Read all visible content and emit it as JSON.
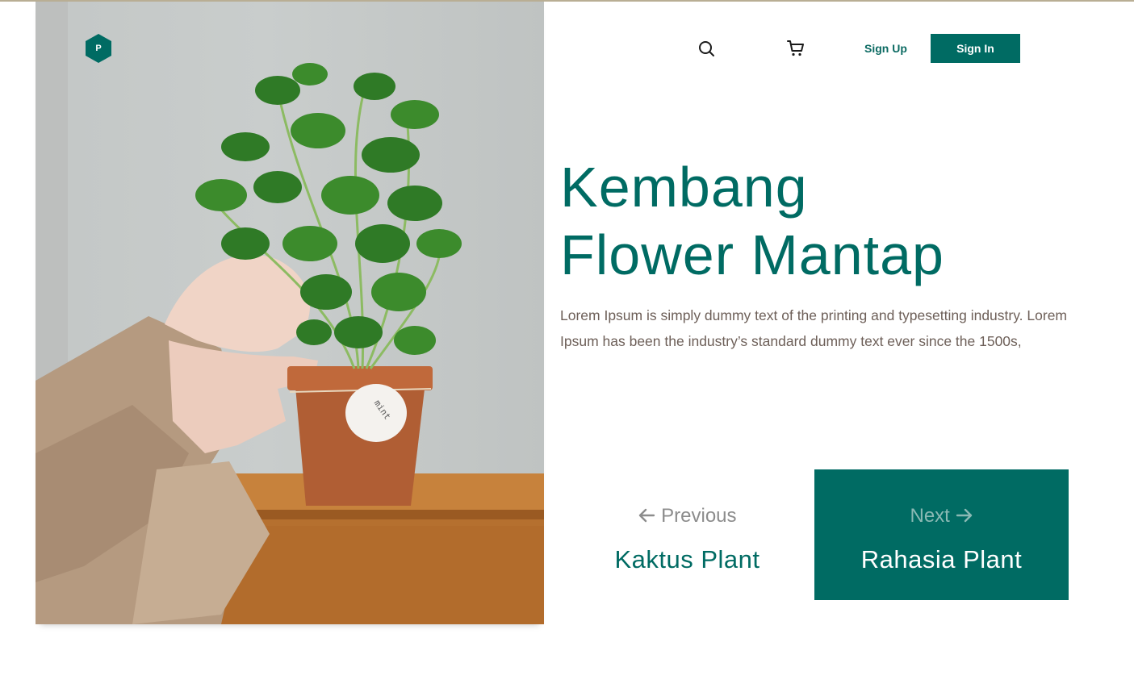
{
  "brand": {
    "logo_letter": "P",
    "color": "#006b63"
  },
  "nav": {
    "search_icon": "search-icon",
    "cart_icon": "cart-icon",
    "signup_label": "Sign Up",
    "signin_label": "Sign In"
  },
  "hero": {
    "image": "potted-mint-plant-photo",
    "pot_tag_text": "mint",
    "title_line1": "Kembang",
    "title_line2": "Flower Mantap",
    "description": "Lorem Ipsum is simply dummy text of the printing and typesetting industry. Lorem Ipsum has been the industry’s standard dummy text ever since the 1500s,"
  },
  "pagination": {
    "previous_label": "Previous",
    "previous_title": "Kaktus Plant",
    "next_label": "Next",
    "next_title": "Rahasia Plant"
  },
  "colors": {
    "accent": "#006b63",
    "text_muted": "#6d5f58",
    "topline": "#b9ae94"
  }
}
